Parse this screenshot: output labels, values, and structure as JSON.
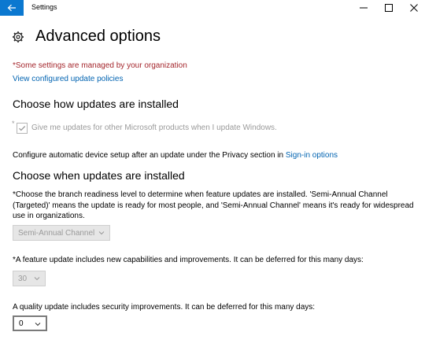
{
  "window": {
    "title": "Settings"
  },
  "page": {
    "title": "Advanced options",
    "managed_notice": "*Some settings are managed by your organization",
    "policies_link": "View configured update policies"
  },
  "install_section": {
    "heading": "Choose how updates are installed",
    "checkbox_label": "Give me updates for other Microsoft products when I update Windows.",
    "checkbox_checked": true,
    "checkbox_asterisk": "*",
    "device_setup_text": "Configure automatic device setup after an update under the Privacy section in",
    "signin_link": "Sign-in options"
  },
  "when_section": {
    "heading": "Choose when updates are installed",
    "branch_desc_line1": "*Choose the branch readiness level to determine when feature updates are installed. 'Semi-Annual Channel",
    "branch_desc_line2": "(Targeted)' means the update is ready for most people, and 'Semi-Annual Channel' means it's ready for widespread",
    "branch_desc_line3": "use in organizations.",
    "branch_value": "Semi-Annual Channel",
    "feature_defer_text": "*A feature update includes new capabilities and improvements. It can be deferred for this many days:",
    "feature_defer_value": "30",
    "quality_defer_text": "A quality update includes security improvements. It can be deferred for this many days:",
    "quality_defer_value": "0"
  },
  "colors": {
    "accent": "#0b78d0",
    "link": "#0063b1",
    "warning": "#a4262c",
    "disabled": "#9a9a9a"
  },
  "icons": [
    "back-arrow-icon",
    "minimize-icon",
    "maximize-icon",
    "close-icon",
    "gear-icon",
    "checkmark-icon",
    "chevron-down-icon"
  ]
}
